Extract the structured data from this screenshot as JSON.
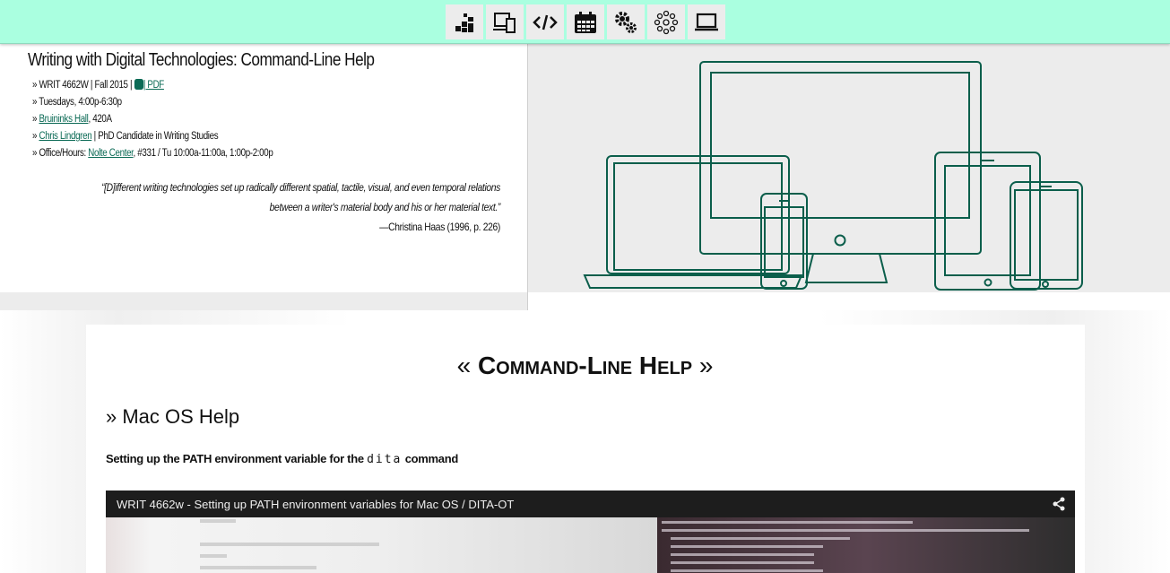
{
  "nav": {
    "items": [
      {
        "name": "home-icon"
      },
      {
        "name": "devices-icon"
      },
      {
        "name": "code-icon"
      },
      {
        "name": "calendar-icon"
      },
      {
        "name": "gears-icon"
      },
      {
        "name": "network-icon"
      },
      {
        "name": "laptop-icon"
      }
    ],
    "accent": "#aaffe0"
  },
  "header": {
    "title": "Writing with Digital Technologies: Command-Line Help",
    "course": "» WRIT 4662W | Fall 2015 | ",
    "pdf_link": "| PDF",
    "time": "» Tuesdays, 4:00p-6:30p",
    "room_link": "Bruininks Hall",
    "room_rest": ", 420A",
    "instructor_link": "Chris Lindgren",
    "instructor_rest": " | PhD Candidate in Writing Studies",
    "office_prefix": "» Office/Hours: ",
    "office_link": "Nolte Center",
    "office_rest": ", #331 / Tu 10:00a-11:00a, 1:00p-2:00p",
    "quote": "“[D]ifferent writing technologies set up radically different spatial, tactile, visual, and even temporal relations between a writer's material body and his or her material text.”",
    "attribution": "—Christina Haas (1996, p. 226)",
    "link_color": "#0b6a55"
  },
  "main": {
    "title_left": "« ",
    "title": "Command-Line Help",
    "title_right": " »",
    "section": "» Mac OS Help",
    "subheading_prefix": "Setting up the PATH environment variable for the ",
    "subheading_code": "dita",
    "subheading_suffix": " command",
    "video_title": "WRIT 4662w - Setting up PATH environment variables for Mac OS / DITA-OT"
  }
}
